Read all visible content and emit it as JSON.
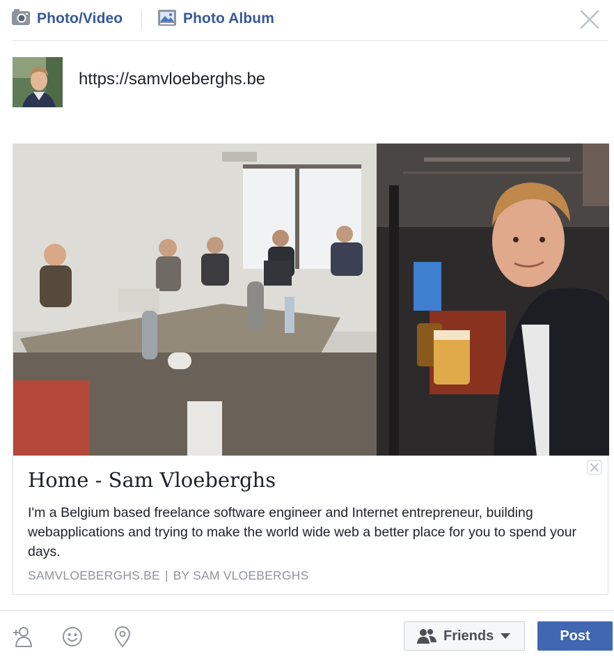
{
  "tabs": {
    "photo_video": "Photo/Video",
    "photo_album": "Photo Album"
  },
  "composer": {
    "text": "https://samvloeberghs.be"
  },
  "link_preview": {
    "title": "Home - Sam Vloeberghs",
    "description": "I'm a Belgium based freelance software engineer and Internet entrepreneur, building webapplications and trying to make the world wide web a better place for you to spend your days.",
    "domain": "SAMVLOEBERGHS.BE",
    "separator": "|",
    "byline": "BY SAM VLOEBERGHS"
  },
  "footer": {
    "audience_label": "Friends",
    "post_label": "Post"
  },
  "icons": {
    "photo_video": "camera-icon",
    "photo_album": "album-icon",
    "close": "close-icon",
    "remove_preview": "close-icon",
    "tag_friends": "tag-person-icon",
    "feeling": "smiley-icon",
    "location": "location-pin-icon",
    "audience": "friends-icon",
    "dropdown": "caret-down-icon"
  },
  "colors": {
    "link_blue": "#365899",
    "post_button": "#4267b2",
    "meta_gray": "#90949c",
    "border": "#dddfe2"
  }
}
